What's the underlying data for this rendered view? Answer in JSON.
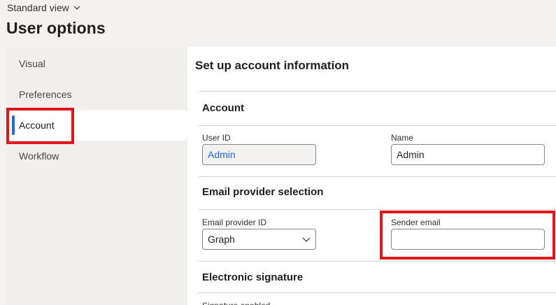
{
  "header": {
    "view_label": "Standard view",
    "page_title": "User options"
  },
  "sidebar": {
    "items": [
      {
        "label": "Visual"
      },
      {
        "label": "Preferences"
      },
      {
        "label": "Account"
      },
      {
        "label": "Workflow"
      }
    ],
    "active": "Account"
  },
  "main": {
    "title": "Set up account information",
    "account_section": {
      "title": "Account",
      "user_id_label": "User ID",
      "user_id_value": "Admin",
      "name_label": "Name",
      "name_value": "Admin"
    },
    "email_section": {
      "title": "Email provider selection",
      "provider_label": "Email provider ID",
      "provider_value": "Graph",
      "sender_label": "Sender email",
      "sender_value": ""
    },
    "signature_section": {
      "title": "Electronic signature",
      "next_label_partial": "Signature enabled"
    }
  },
  "colors": {
    "accent": "#2266e3",
    "highlight": "#e0161b",
    "background": "#f3f2f1"
  }
}
